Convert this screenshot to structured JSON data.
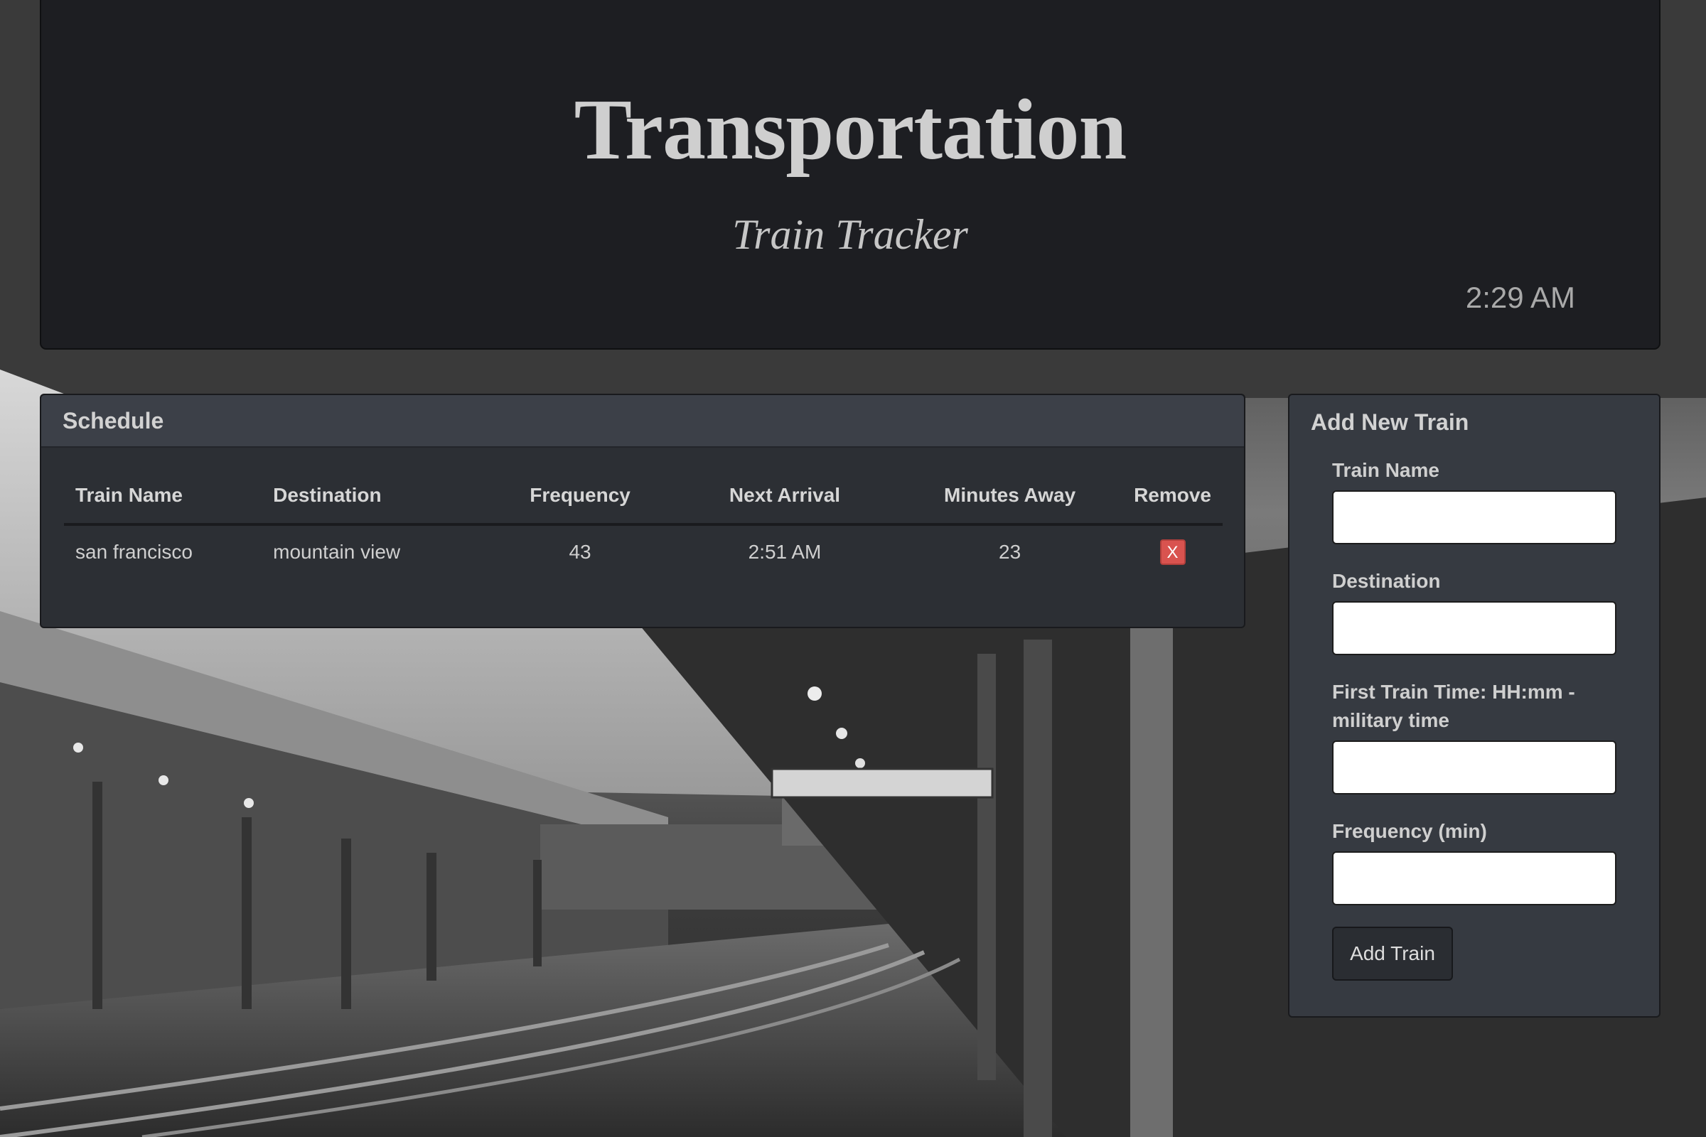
{
  "header": {
    "title": "Transportation",
    "subtitle": "Train Tracker",
    "clock": "2:29 AM"
  },
  "schedule": {
    "title": "Schedule",
    "columns": [
      "Train Name",
      "Destination",
      "Frequency",
      "Next Arrival",
      "Minutes Away",
      "Remove"
    ],
    "rows": [
      {
        "train_name": "san francisco",
        "destination": "mountain view",
        "frequency": "43",
        "next_arrival": "2:51 AM",
        "minutes_away": "23",
        "remove_label": "X"
      }
    ]
  },
  "add_train": {
    "title": "Add New Train",
    "fields": [
      {
        "label": "Train Name",
        "value": ""
      },
      {
        "label": "Destination",
        "value": ""
      },
      {
        "label": "First Train Time: HH:mm - military time",
        "value": ""
      },
      {
        "label": "Frequency (min)",
        "value": ""
      }
    ],
    "submit_label": "Add Train"
  },
  "colors": {
    "jumbotron_bg": "#1d1e22",
    "panel_bg": "#2c2f34",
    "panel_heading_bg": "#3c4048",
    "remove_button": "#d9534f"
  }
}
